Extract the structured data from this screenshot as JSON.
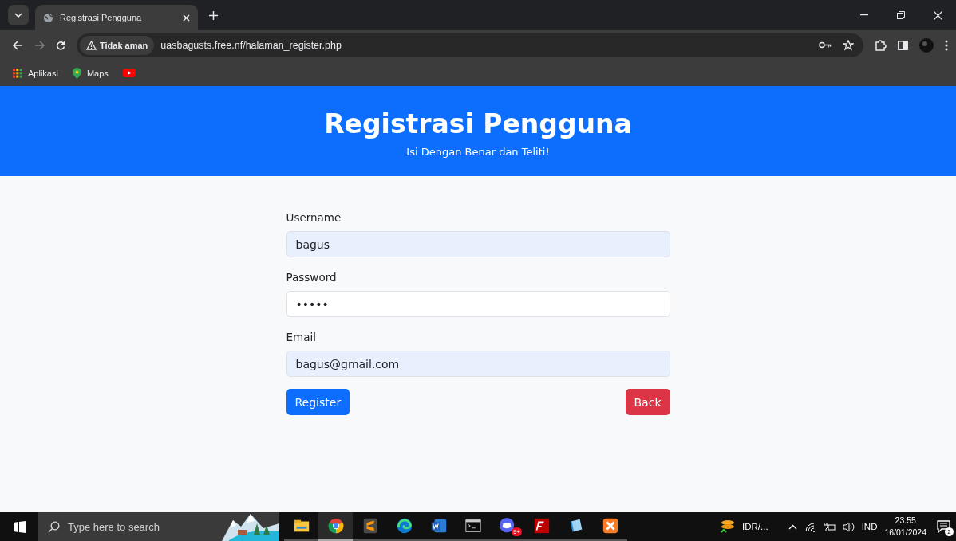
{
  "browser": {
    "tab_title": "Registrasi Pengguna",
    "security_label": "Tidak aman",
    "url": "uasbagusts.free.nf/halaman_register.php",
    "bookmarks": [
      {
        "kind": "apps",
        "label": "Aplikasi"
      },
      {
        "kind": "maps",
        "label": "Maps"
      },
      {
        "kind": "youtube"
      }
    ]
  },
  "header": {
    "title": "Registrasi Pengguna",
    "subtitle": "Isi Dengan Benar dan Teliti!"
  },
  "form": {
    "fields": [
      {
        "label": "Username",
        "value": "bagus",
        "autofilled": true
      },
      {
        "label": "Password",
        "value": "•••••",
        "autofilled": false
      },
      {
        "label": "Email",
        "value": "bagus@gmail.com",
        "autofilled": true
      }
    ],
    "buttons": [
      {
        "label": "Register",
        "kind": "primary"
      },
      {
        "label": "Back",
        "kind": "danger"
      }
    ]
  },
  "taskbar": {
    "search_placeholder": "Type here to search",
    "apps": [
      {
        "kind": "explorer",
        "selected": false
      },
      {
        "kind": "chrome",
        "selected": true
      },
      {
        "kind": "sublime",
        "selected": false
      },
      {
        "kind": "edge",
        "selected": false
      },
      {
        "kind": "word",
        "selected": false
      },
      {
        "kind": "terminal",
        "selected": false
      },
      {
        "kind": "discord",
        "badge": "9+",
        "selected": false
      },
      {
        "kind": "filezilla",
        "selected": false
      },
      {
        "kind": "notepad",
        "selected": false
      },
      {
        "kind": "xampp",
        "selected": false
      }
    ],
    "currency": "IDR/...",
    "language": "IND",
    "time": "23.55",
    "date": "16/01/2024",
    "notifications": "2"
  }
}
